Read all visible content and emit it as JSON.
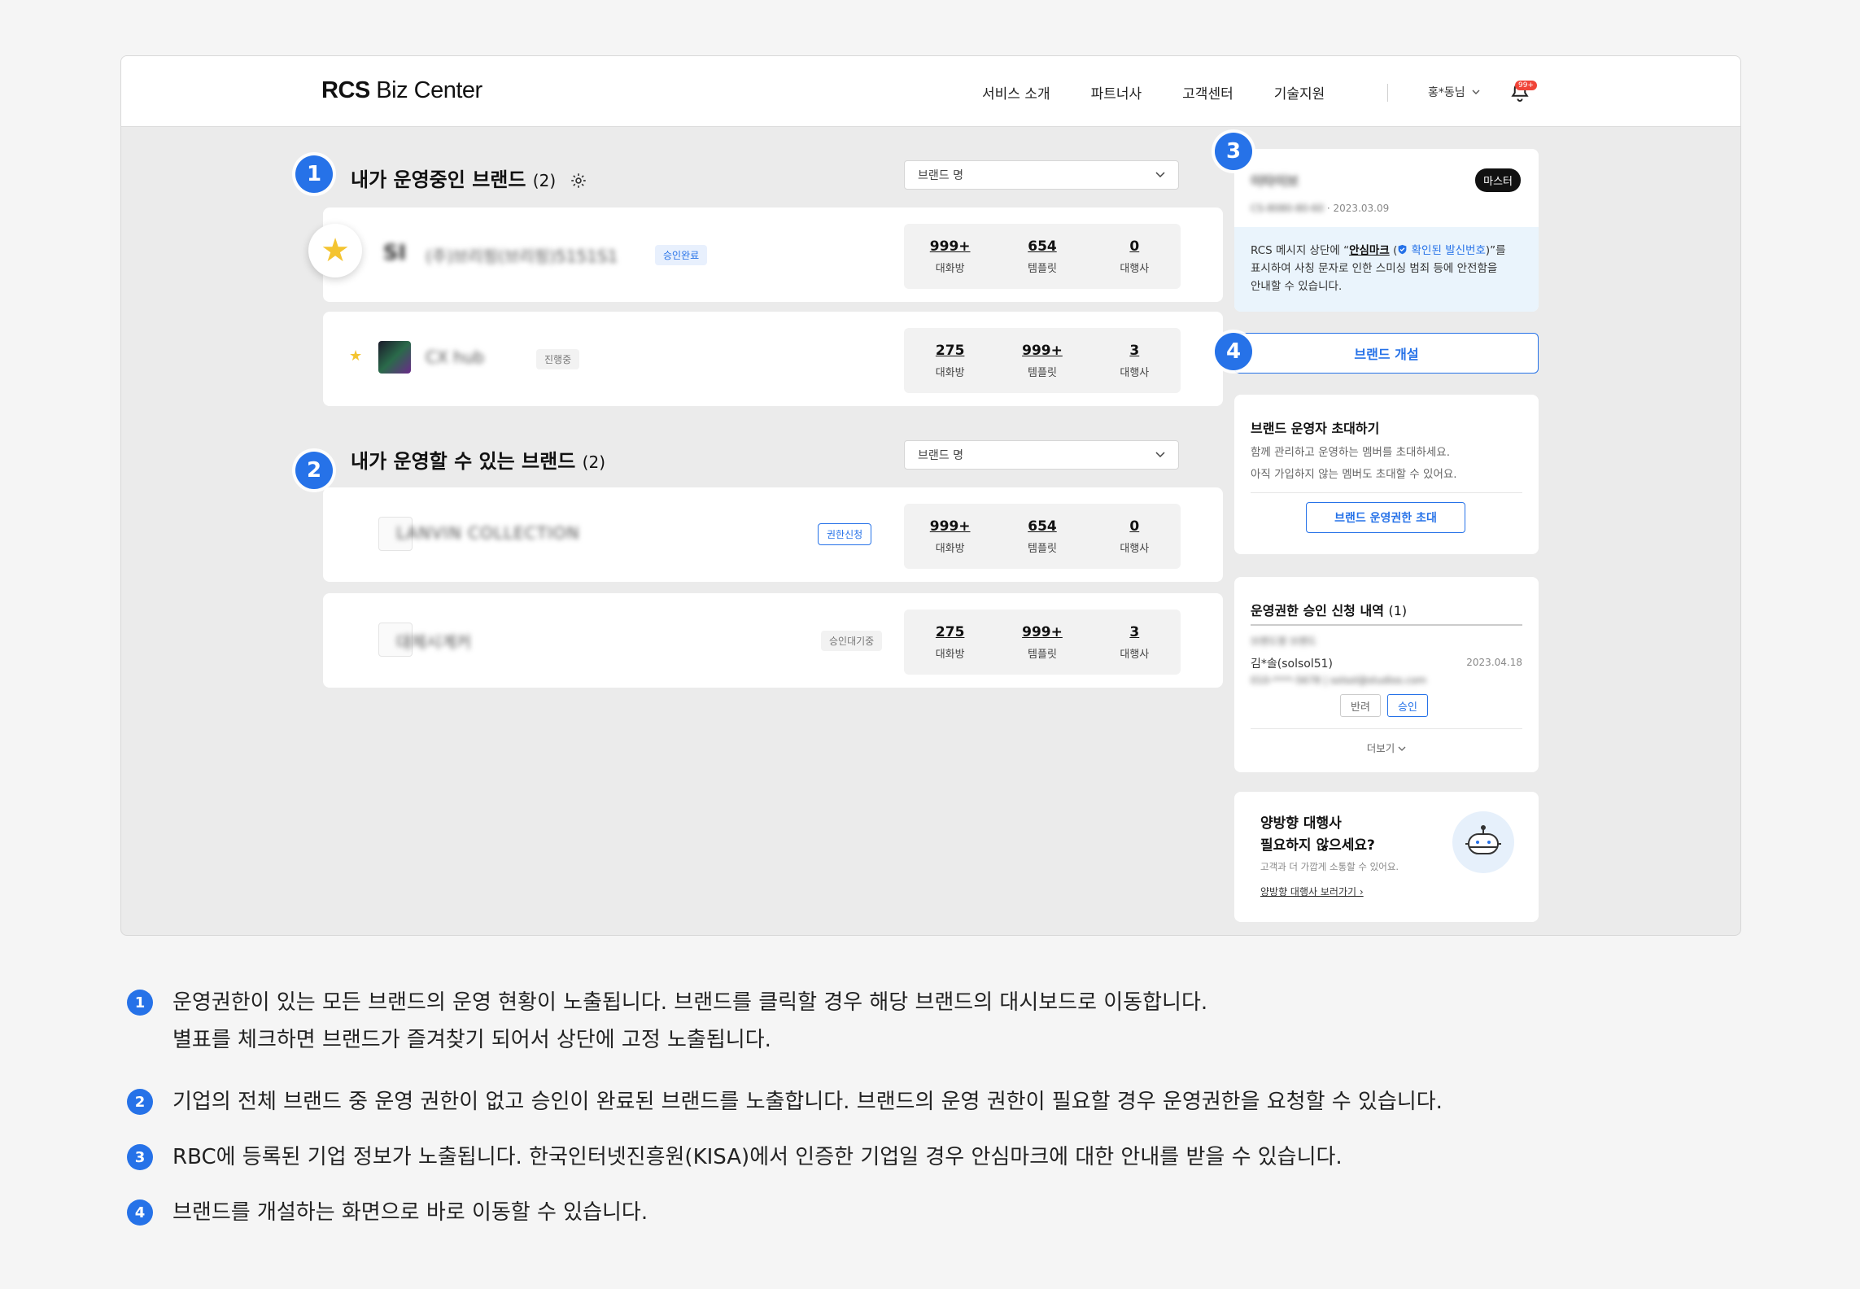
{
  "header": {
    "logo_bold": "RCS",
    "logo_rest": " Biz Center",
    "nav": [
      "서비스 소개",
      "파트너사",
      "고객센터",
      "기술지원"
    ],
    "user_label": "홍*동님",
    "notification_badge": "99+"
  },
  "markers": [
    "1",
    "2",
    "3",
    "4"
  ],
  "operating_brands": {
    "title": "내가 운영중인 브랜드",
    "count": "(2)",
    "select_value": "브랜드 명",
    "items": [
      {
        "name": "(주)브리핑(브리핑)5151S1",
        "logo_text": "SI",
        "status": "승인완료",
        "stats": [
          {
            "num": "999+",
            "label": "대화방"
          },
          {
            "num": "654",
            "label": "템플릿"
          },
          {
            "num": "0",
            "label": "대행사"
          }
        ]
      },
      {
        "name": "CX hub",
        "status": "진행중",
        "stats": [
          {
            "num": "275",
            "label": "대화방"
          },
          {
            "num": "999+",
            "label": "템플릿"
          },
          {
            "num": "3",
            "label": "대행사"
          }
        ]
      }
    ]
  },
  "available_brands": {
    "title": "내가 운영할 수 있는 브랜드",
    "count": "(2)",
    "select_value": "브랜드 명",
    "items": [
      {
        "name": "LANVIN COLLECTION",
        "status": "권한신청",
        "stats": [
          {
            "num": "999+",
            "label": "대화방"
          },
          {
            "num": "654",
            "label": "템플릿"
          },
          {
            "num": "0",
            "label": "대행사"
          }
        ]
      },
      {
        "name": "대체시계커",
        "status": "승인대기중",
        "stats": [
          {
            "num": "275",
            "label": "대화방"
          },
          {
            "num": "999+",
            "label": "템플릿"
          },
          {
            "num": "3",
            "label": "대행사"
          }
        ]
      }
    ]
  },
  "company": {
    "name": "이타이브",
    "reg_no": "CS-8080-80-60",
    "date": "2023.03.09",
    "role_badge": "마스터",
    "kisa_pre": "RCS 메시지 상단에 “",
    "kisa_mark": "안심마크",
    "kisa_mid": " (",
    "kisa_verified": "확인된 발신번호",
    "kisa_post": ")”를",
    "kisa_line2": "표시하여 사칭 문자로 인한 스미싱 범죄 등에 안전함을",
    "kisa_line3": "안내할 수 있습니다."
  },
  "open_brand_button": "브랜드 개설",
  "invite": {
    "title": "브랜드 운영자 초대하기",
    "desc1": "함께 관리하고 운영하는 멤버를 초대하세요.",
    "desc2": "아직 가입하지 않는 멤버도 초대할 수 있어요.",
    "button": "브랜드 운영권한 초대"
  },
  "requests": {
    "title": "운영권한 승인 신청 내역",
    "count": "(1)",
    "brand": "브랜드명 브랜드",
    "requester": "김*솔(solsol51)",
    "date": "2023.04.18",
    "contact": "010-****-5678 | solsol@studios.com",
    "reject": "반려",
    "approve": "승인",
    "more": "더보기"
  },
  "promo": {
    "title1": "양방향 대행사",
    "title2": "필요하지 않으세요?",
    "desc": "고객과 더 가깝게 소통할 수 있어요.",
    "link": "양방향 대행사 보러가기"
  },
  "notes": [
    {
      "num": "1",
      "line1": "운영권한이 있는 모든 브랜드의 운영 현황이 노출됩니다. 브랜드를 클릭할 경우 해당 브랜드의 대시보드로 이동합니다.",
      "line2": "별표를 체크하면 브랜드가 즐겨찾기 되어서 상단에 고정 노출됩니다."
    },
    {
      "num": "2",
      "line1": "기업의 전체 브랜드 중 운영 권한이 없고 승인이 완료된 브랜드를 노출합니다. 브랜드의 운영 권한이 필요할 경우 운영권한을 요청할 수 있습니다."
    },
    {
      "num": "3",
      "line1": "RBC에 등록된 기업 정보가 노출됩니다. 한국인터넷진흥원(KISA)에서 인증한 기업일 경우 안심마크에 대한 안내를 받을 수 있습니다."
    },
    {
      "num": "4",
      "line1": "브랜드를 개설하는 화면으로 바로 이동할 수 있습니다."
    }
  ],
  "colors": {
    "accent": "#2672e8",
    "star": "#f4c430",
    "background": "#ebebeb"
  }
}
